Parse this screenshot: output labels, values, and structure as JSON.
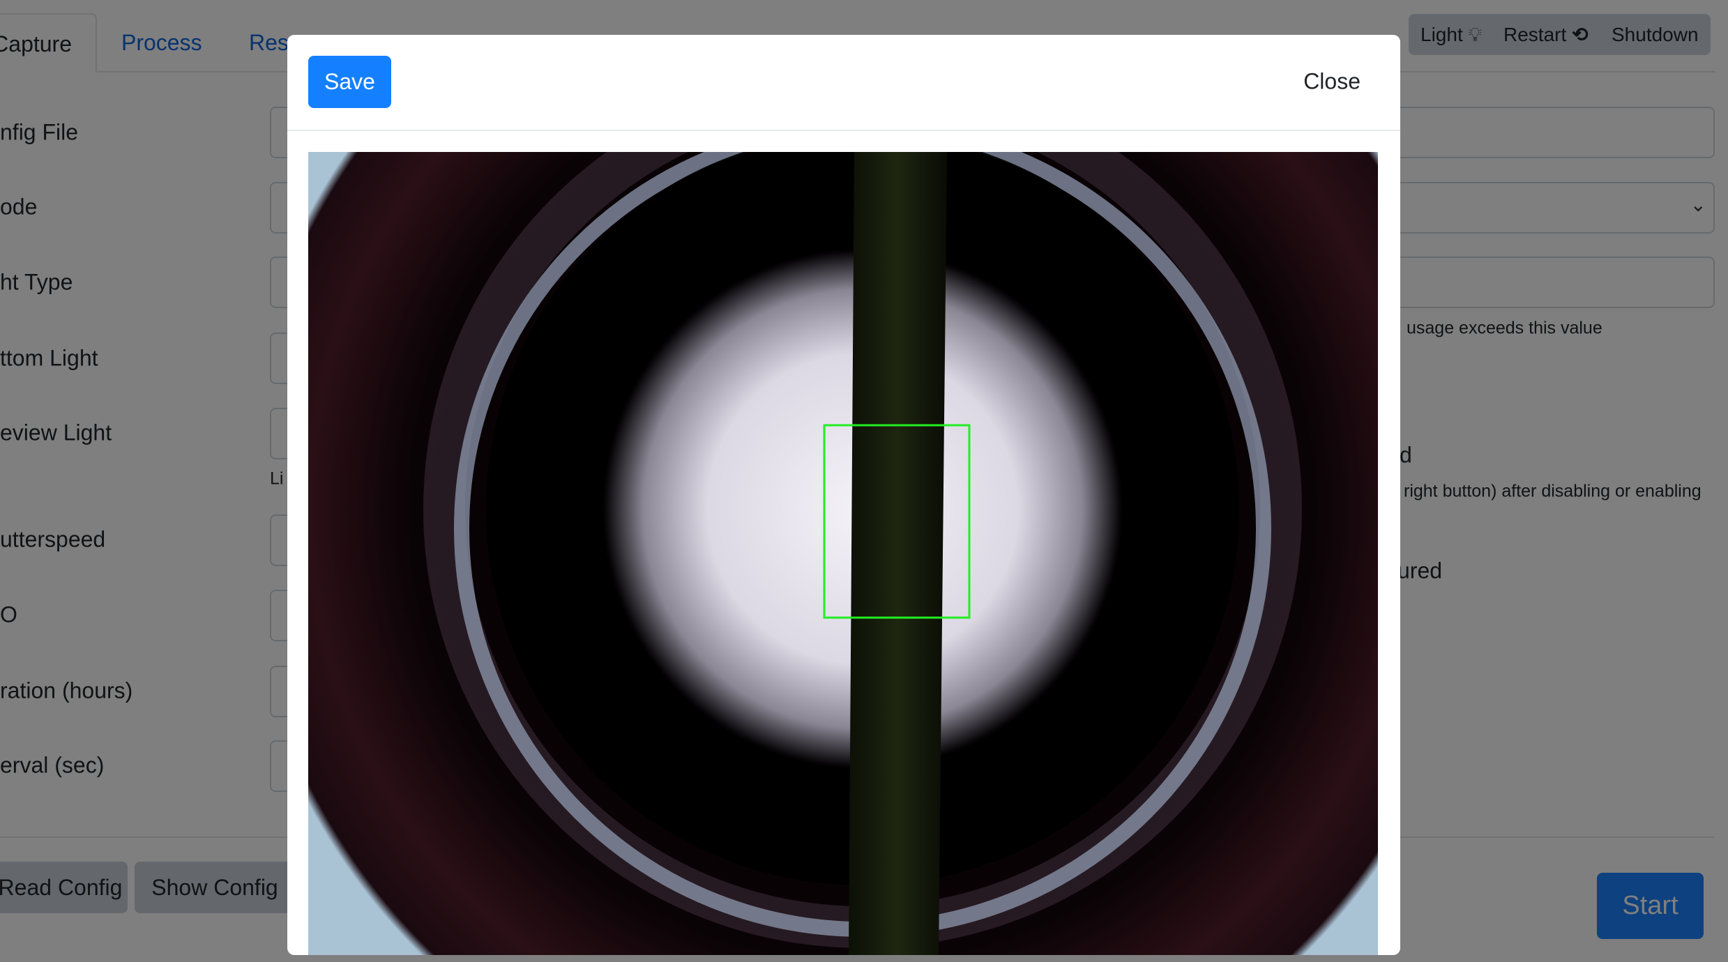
{
  "tabs": [
    {
      "label": "Capture",
      "active": true
    },
    {
      "label": "Process"
    },
    {
      "label": "Res"
    }
  ],
  "toolbar": {
    "light": "Light",
    "light_icon": "lightbulb-icon",
    "restart": "Restart",
    "restart_icon": "restart-arrow-icon",
    "shutdown": "Shutdown"
  },
  "form": {
    "labels": [
      "nfig File",
      "ode",
      "ht Type",
      "ttom Light",
      "eview Light",
      "utterspeed",
      "O",
      "ration (hours)",
      "erval (sec)"
    ],
    "preview_light_help": "Li",
    "usage_help": "usage exceeds this value",
    "section_d": "d",
    "restart_help": "right button) after disabling or enabling",
    "section_ured": "ured"
  },
  "buttons": {
    "read_config": "Read Config",
    "show_config": "Show Config",
    "start": "Start"
  },
  "modal": {
    "save": "Save",
    "close": "Close",
    "roi_color": "#22ee22"
  },
  "colors": {
    "primary": "#1580ff",
    "overlay": "rgba(0,0,0,0.5)"
  }
}
